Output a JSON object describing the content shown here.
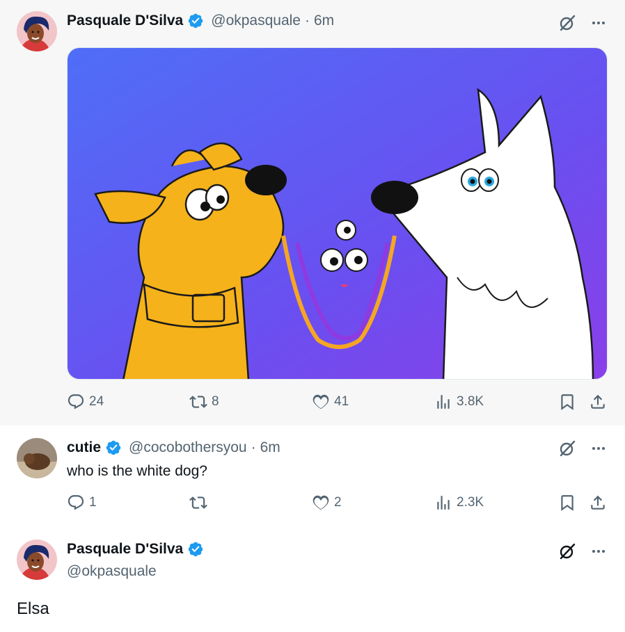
{
  "tweets": [
    {
      "author": "Pasquale D'Silva",
      "handle": "@okpasquale",
      "time": "6m",
      "stats": {
        "replies": "24",
        "reposts": "8",
        "likes": "41",
        "views": "3.8K"
      }
    },
    {
      "author": "cutie",
      "handle": "@cocobothersyou",
      "time": "6m",
      "text": "who is the white dog?",
      "stats": {
        "replies": "1",
        "reposts": "",
        "likes": "2",
        "views": "2.3K"
      }
    },
    {
      "author": "Pasquale D'Silva",
      "handle": "@okpasquale",
      "text": "Elsa"
    }
  ],
  "separator": "·",
  "colors": {
    "verified": "#1d9bf0",
    "secondary_text": "#536471",
    "media_bg": "#5b5ff5"
  },
  "icons": [
    "verified-badge-icon",
    "grok-icon",
    "more-icon",
    "reply-icon",
    "repost-icon",
    "like-icon",
    "views-icon",
    "bookmark-icon",
    "share-icon"
  ]
}
